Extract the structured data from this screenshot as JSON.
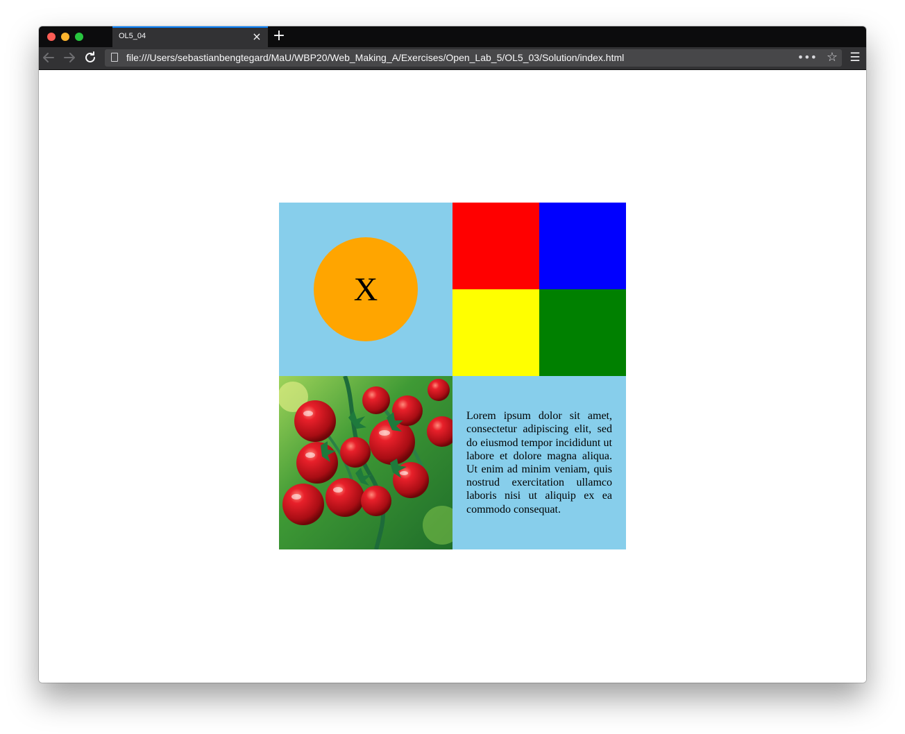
{
  "browser": {
    "tab_title": "OL5_04",
    "tab_close_icon": "×",
    "new_tab_icon": "+",
    "url": "file:///Users/sebastianbengtegard/MaU/WBP20/Web_Making_A/Exercises/Open_Lab_5/OL5_03/Solution/index.html",
    "colors": {
      "traffic_red": "#fd5d55",
      "traffic_yellow": "#feb52e",
      "traffic_green": "#28c63f",
      "tab_accent": "#0a84ff"
    }
  },
  "page": {
    "circle_label": "X",
    "lorem": "Lorem ipsum dolor sit amet, consectetur adipiscing elit, sed do eiusmod tempor incididunt ut labore et dolore magna aliqua. Ut enim ad minim veniam, quis nostrud exercitation ullamco laboris nisi ut aliquip ex ea commodo consequat.",
    "image": "tomatoes-photo",
    "colors": {
      "cell_bg": "#87ceeb",
      "circle": "#ffa500",
      "q1": "#ff0000",
      "q2": "#0000ff",
      "q3": "#ffff00",
      "q4": "#008000"
    }
  }
}
